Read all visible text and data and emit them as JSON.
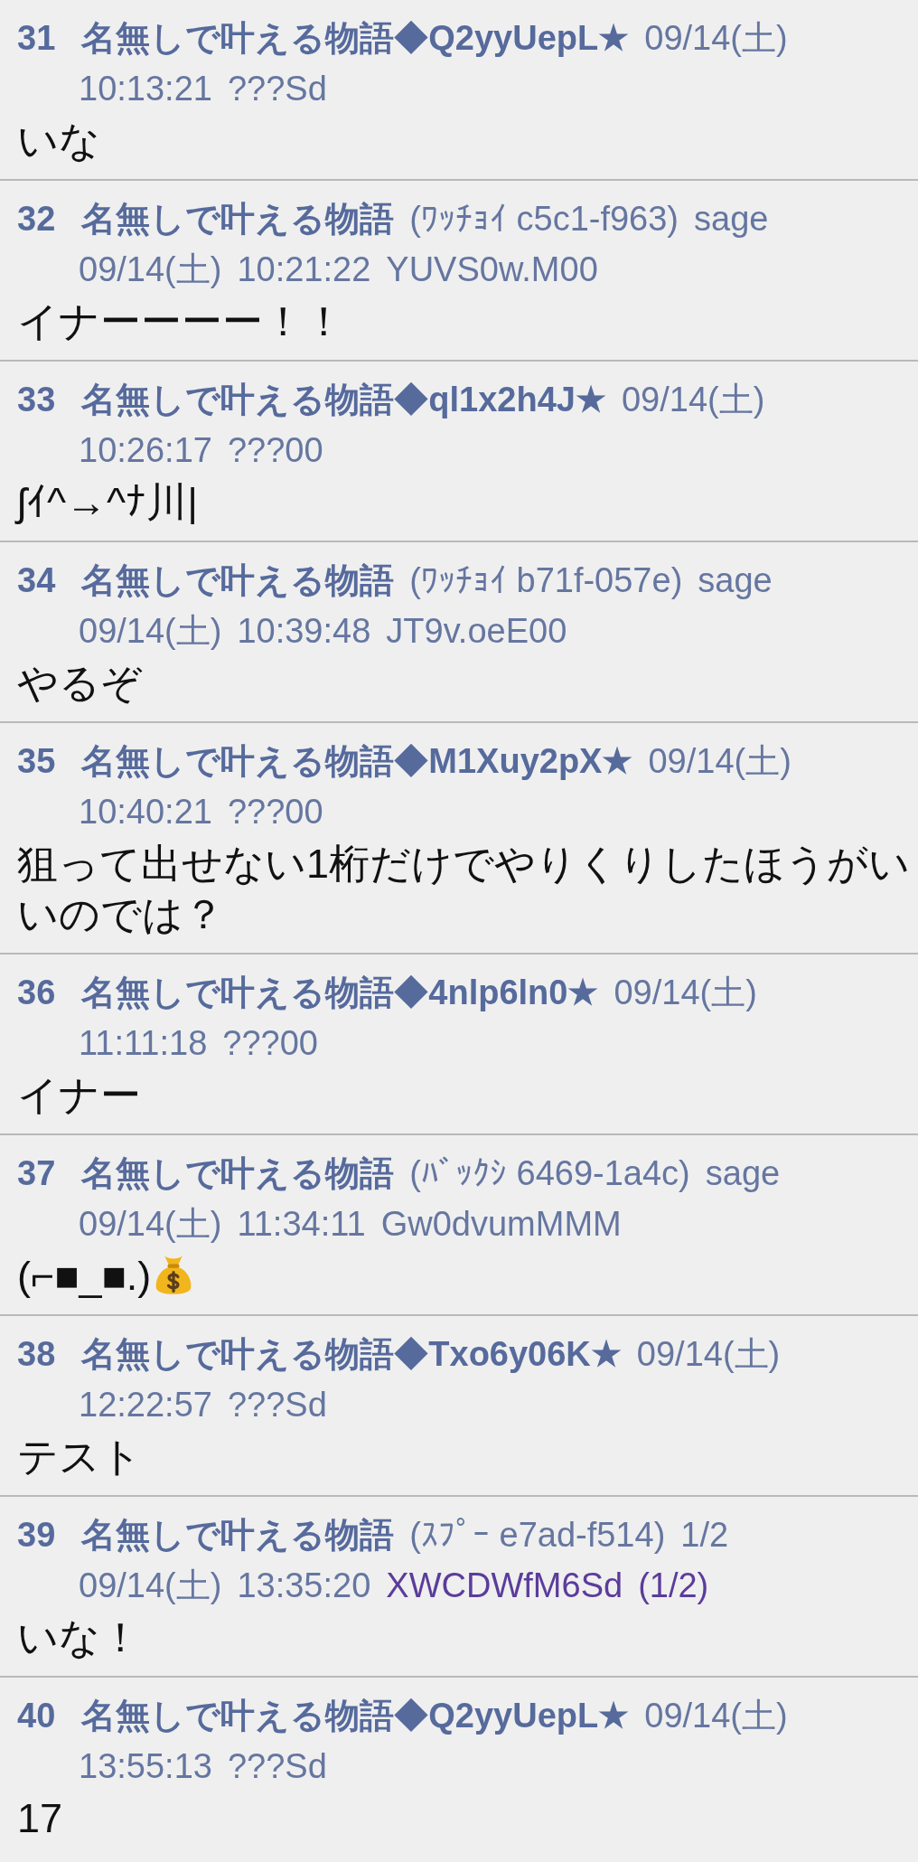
{
  "posts": [
    {
      "number": "31",
      "name": "名無しで叶える物語◆Q2yyUepL★",
      "date": "09/14(土)",
      "time": "10:13:21",
      "id": "???Sd",
      "id_highlighted": false,
      "body": "いな",
      "emoji": false
    },
    {
      "number": "32",
      "name": "名無しで叶える物語",
      "tag": "(ﾜｯﾁｮｲ c5c1-f963)",
      "mail": "sage",
      "date": "09/14(土)",
      "time": "10:21:22",
      "id": "YUVS0w.M00",
      "id_highlighted": false,
      "body": "イナーーーー！！",
      "emoji": false
    },
    {
      "number": "33",
      "name": "名無しで叶える物語◆ql1x2h4J★",
      "date": "09/14(土)",
      "time": "10:26:17",
      "id": "???00",
      "id_highlighted": false,
      "body": "ʃｲ^→^ﾅ川|",
      "emoji": false
    },
    {
      "number": "34",
      "name": "名無しで叶える物語",
      "tag": "(ﾜｯﾁｮｲ b71f-057e)",
      "mail": "sage",
      "date": "09/14(土)",
      "time": "10:39:48",
      "id": "JT9v.oeE00",
      "id_highlighted": false,
      "body": "やるぞ",
      "emoji": false
    },
    {
      "number": "35",
      "name": "名無しで叶える物語◆M1Xuy2pX★",
      "date": "09/14(土)",
      "time": "10:40:21",
      "id": "???00",
      "id_highlighted": false,
      "body": "狙って出せない1桁だけでやりくりしたほうがいいのでは？",
      "emoji": false
    },
    {
      "number": "36",
      "name": "名無しで叶える物語◆4nlp6ln0★",
      "date": "09/14(土)",
      "time": "11:11:18",
      "id": "???00",
      "id_highlighted": false,
      "body": "イナー",
      "emoji": false
    },
    {
      "number": "37",
      "name": "名無しで叶える物語",
      "tag": "(ﾊﾞｯｸｼ 6469-1a4c)",
      "mail": "sage",
      "date": "09/14(土)",
      "time": "11:34:11",
      "id": "Gw0dvumMMM",
      "id_highlighted": false,
      "body": "(⌐■_■.)",
      "emoji": true
    },
    {
      "number": "38",
      "name": "名無しで叶える物語◆Txo6y06K★",
      "date": "09/14(土)",
      "time": "12:22:57",
      "id": "???Sd",
      "id_highlighted": false,
      "body": "テスト",
      "emoji": false
    },
    {
      "number": "39",
      "name": "名無しで叶える物語",
      "tag": "(ｽﾌﾟｰ e7ad-f514)",
      "mail": "1/2",
      "date": "09/14(土)",
      "time": "13:35:20",
      "id": "XWCDWfM6Sd",
      "id_count": "(1/2)",
      "id_highlighted": true,
      "body": "いな！",
      "emoji": false
    },
    {
      "number": "40",
      "name": "名無しで叶える物語◆Q2yyUepL★",
      "date": "09/14(土)",
      "time": "13:55:13",
      "id": "???Sd",
      "id_highlighted": false,
      "body": "17",
      "emoji": false
    }
  ]
}
